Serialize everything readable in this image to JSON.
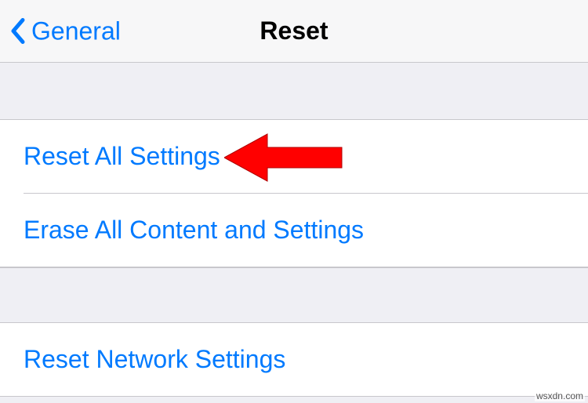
{
  "nav": {
    "back_label": "General",
    "title": "Reset"
  },
  "group1": {
    "item1": "Reset All Settings",
    "item2": "Erase All Content and Settings"
  },
  "group2": {
    "item1": "Reset Network Settings"
  },
  "watermark": "wsxdn.com",
  "colors": {
    "link": "#007aff",
    "arrow": "#ff0000"
  }
}
